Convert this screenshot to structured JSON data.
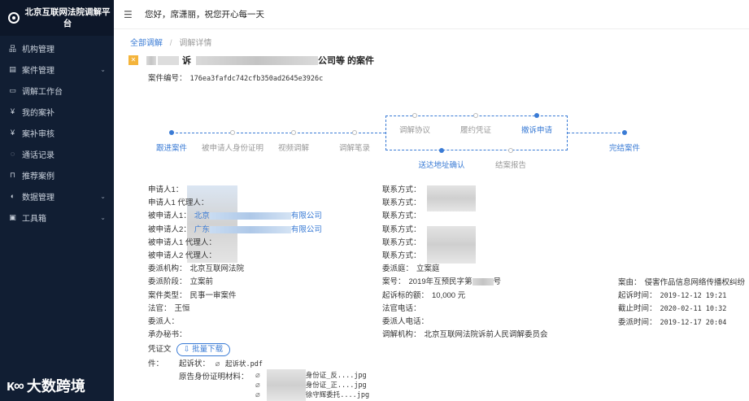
{
  "sidebar": {
    "brand_title": "北京互联网法院调解平台",
    "items": [
      {
        "label": "机构管理",
        "icon": "org-icon",
        "glyph": "品",
        "caret": false
      },
      {
        "label": "案件管理",
        "icon": "case-icon",
        "glyph": "▤",
        "caret": true
      },
      {
        "label": "调解工作台",
        "icon": "monitor-icon",
        "glyph": "▭",
        "caret": false
      },
      {
        "label": "我的案补",
        "icon": "yen-icon",
        "glyph": "¥",
        "caret": false
      },
      {
        "label": "案补审核",
        "icon": "audit-icon",
        "glyph": "¥",
        "caret": false
      },
      {
        "label": "通话记录",
        "icon": "chat-icon",
        "glyph": "◌",
        "caret": false
      },
      {
        "label": "推荐案例",
        "icon": "lock-icon",
        "glyph": "⊓",
        "caret": false
      },
      {
        "label": "数据管理",
        "icon": "data-icon",
        "glyph": "◐",
        "caret": true
      },
      {
        "label": "工具箱",
        "icon": "toolbox-icon",
        "glyph": "▣",
        "caret": true
      }
    ],
    "watermark_icon": "ᴋ∞",
    "watermark_text": "大数跨境"
  },
  "header": {
    "greeting": "您好，席潇丽，祝您开心每一天"
  },
  "breadcrumb": {
    "root": "全部调解",
    "separator": "/",
    "current": "调解详情"
  },
  "case": {
    "title_part1": "诉",
    "title_part2": "公司等 的案件",
    "number_label": "案件编号：",
    "number_value": "176ea3fafdc742cfb350ad2645e3926c"
  },
  "timeline": {
    "main_steps": [
      "跟进案件",
      "被申请人身份证明",
      "视频调解",
      "调解笔录",
      "完结案件"
    ],
    "box_top_steps": [
      "调解协议",
      "履约凭证",
      "撤诉申请"
    ],
    "box_bottom_steps": [
      "送达地址确认",
      "结案报告"
    ]
  },
  "left_info": [
    {
      "label": "申请人1：",
      "value": "",
      "link": false
    },
    {
      "label": "申请人1 代理人：",
      "value": "",
      "link": false
    },
    {
      "label": "被申请人1：",
      "value": "北京",
      "value2": "有限公司",
      "link": true
    },
    {
      "label": "被申请人2：",
      "value": "广东",
      "value2": "有限公司",
      "link": true
    },
    {
      "label": "被申请人1 代理人：",
      "value": "",
      "link": false
    },
    {
      "label": "被申请人2 代理人：",
      "value": "",
      "link": false
    },
    {
      "label": "委派机构：",
      "value": "北京互联网法院",
      "link": false
    },
    {
      "label": "委派阶段：",
      "value": "立案前",
      "link": false
    },
    {
      "label": "案件类型：",
      "value": "民事一审案件",
      "link": false
    },
    {
      "label": "法官：",
      "value": "王恒",
      "link": false
    },
    {
      "label": "委派人：",
      "value": "",
      "link": false
    },
    {
      "label": "承办秘书：",
      "value": "",
      "link": false
    }
  ],
  "mid_info": [
    {
      "label": "联系方式：",
      "value": ""
    },
    {
      "label": "联系方式：",
      "value": ""
    },
    {
      "label": "联系方式：",
      "value": ""
    },
    {
      "label": "联系方式：",
      "value": ""
    },
    {
      "label": "联系方式：",
      "value": ""
    },
    {
      "label": "联系方式：",
      "value": ""
    },
    {
      "label": "委派庭：",
      "value": "立案庭"
    },
    {
      "label": "案号：",
      "value": "2019年互预民字第",
      "value2": "号"
    },
    {
      "label": "起诉标的额：",
      "value": "10,000 元"
    },
    {
      "label": "法官电话：",
      "value": ""
    },
    {
      "label": "委派人电话：",
      "value": ""
    },
    {
      "label": "调解机构：",
      "value": "北京互联网法院诉前人民调解委员会"
    }
  ],
  "right_info": [
    {
      "label": "案由：",
      "value": "侵害作品信息网络传播权纠纷"
    },
    {
      "label": "起诉时间：",
      "value": "2019-12-12 19:21"
    },
    {
      "label": "截止时间：",
      "value": "2020-02-11 10:32"
    },
    {
      "label": "委派时间：",
      "value": "2019-12-17 20:04"
    }
  ],
  "evidence": {
    "label_line1": "凭证文",
    "label_line2": "件：",
    "download_label": "批量下载",
    "complaint_label": "起诉状：",
    "complaint_file": "起诉状.pdf",
    "id_label": "原告身份证明材料：",
    "files": [
      "身份证_反....jpg",
      "身份证_正....jpg",
      "徐守辉委托....jpg"
    ]
  }
}
